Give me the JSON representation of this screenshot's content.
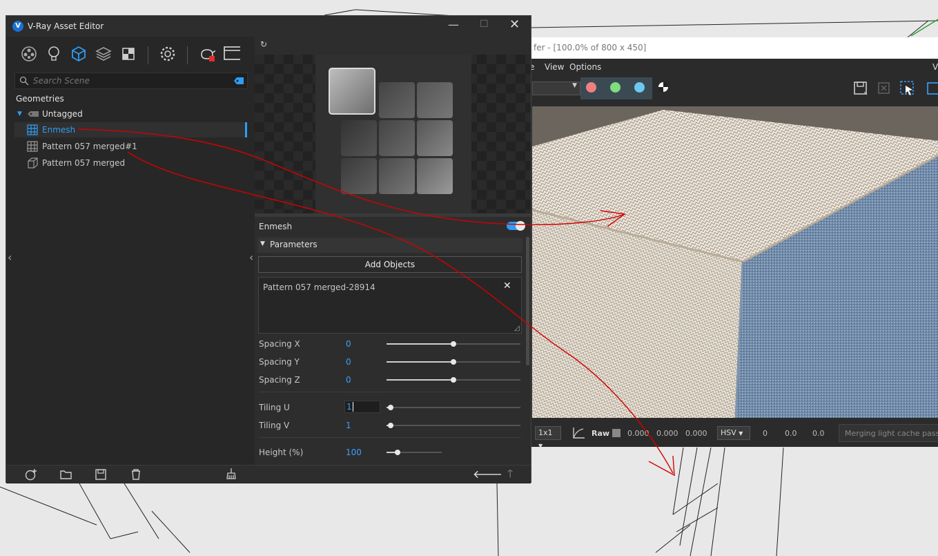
{
  "asset_editor": {
    "title": "V-Ray Asset Editor",
    "search_placeholder": "Search Scene",
    "tree": {
      "category": "Geometries",
      "group": "Untagged",
      "items": [
        "Enmesh",
        "Pattern 057 merged#1",
        "Pattern 057 merged"
      ]
    },
    "panel": {
      "object_name": "Enmesh",
      "section": "Parameters",
      "add_objects_label": "Add Objects",
      "object_list": [
        "Pattern 057 merged-28914"
      ],
      "params": [
        {
          "label": "Spacing X",
          "value": "0",
          "slider": 0.5
        },
        {
          "label": "Spacing Y",
          "value": "0",
          "slider": 0.5
        },
        {
          "label": "Spacing Z",
          "value": "0",
          "slider": 0.5
        },
        {
          "label": "Tiling U",
          "value": "1",
          "slider": 0.03
        },
        {
          "label": "Tiling V",
          "value": "1",
          "slider": 0.03
        },
        {
          "label": "Height (%)",
          "value": "100",
          "slider": 0.2
        }
      ]
    }
  },
  "frame_buffer": {
    "title": "fer - [100.0% of 800 x 450]",
    "menu": [
      "e",
      "View",
      "Options"
    ],
    "menu_right": "V",
    "status": {
      "region": "1x1",
      "raw_label": "Raw",
      "rgb": [
        "0.000",
        "0.000",
        "0.000"
      ],
      "color_mode": "HSV",
      "hsv": [
        "0",
        "0.0",
        "0.0"
      ],
      "message": "Merging light cache passes..."
    }
  },
  "colors": {
    "accent": "#2e9df5",
    "annotation": "#d40000"
  }
}
